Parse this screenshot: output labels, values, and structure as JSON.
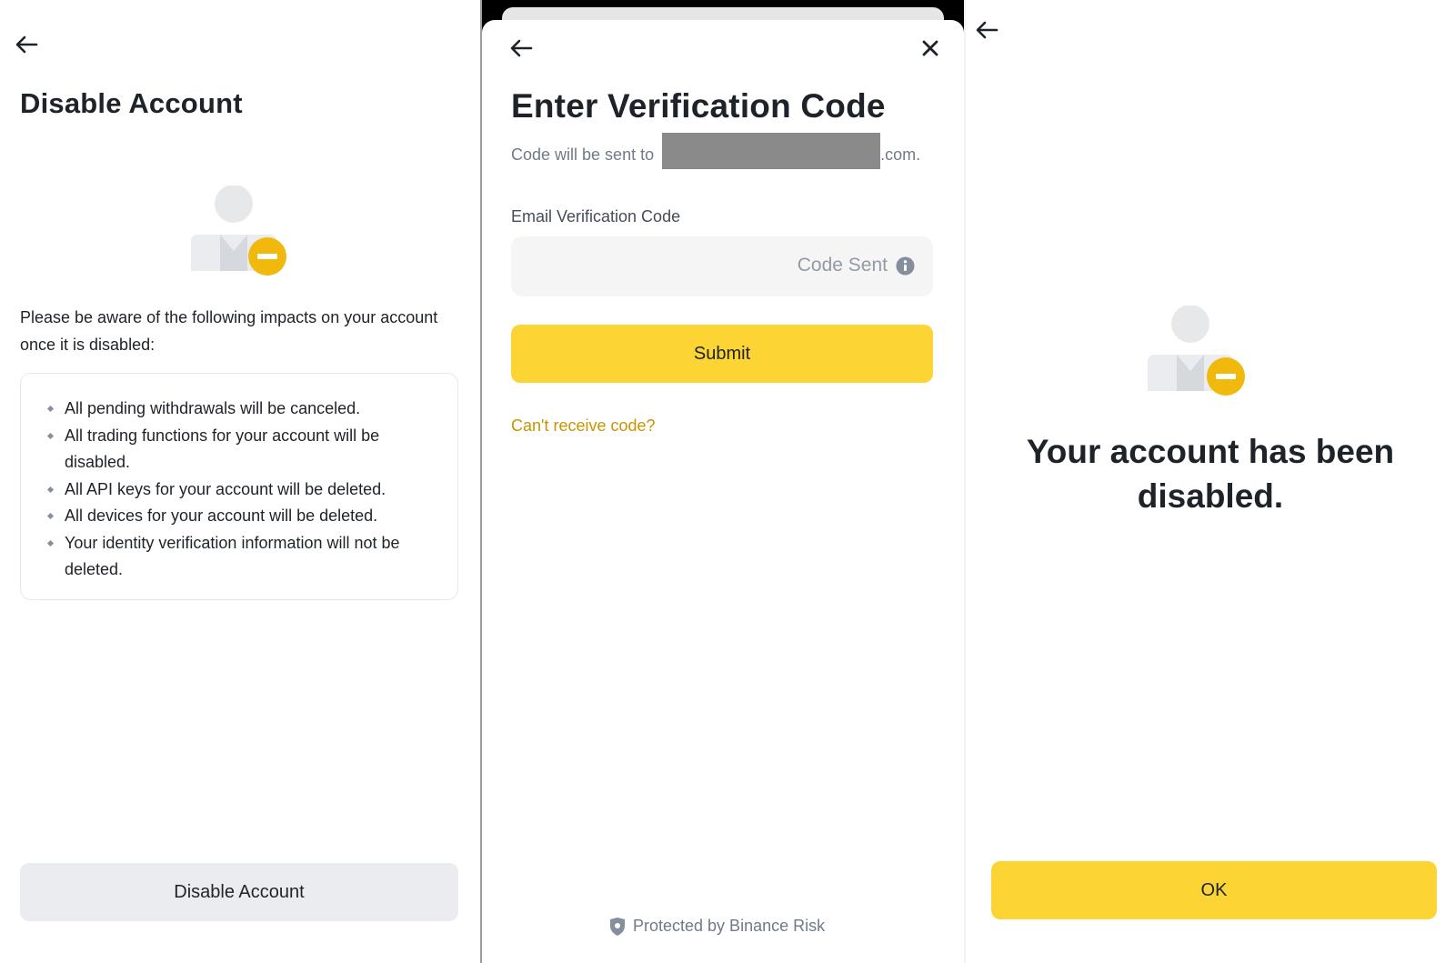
{
  "screen1": {
    "back_icon": "arrow-left-icon",
    "title": "Disable Account",
    "avatar_icon": "user-disabled-icon",
    "intro": "Please be aware of the following impacts on your account once it is disabled:",
    "impacts": [
      "All pending withdrawals will be canceled.",
      "All trading functions for your account will be disabled.",
      "All API keys for your account will be deleted.",
      "All devices for your account will be deleted.",
      "Your identity verification information will not be deleted."
    ],
    "button_label": "Disable Account"
  },
  "screen2": {
    "back_icon": "arrow-left-icon",
    "close_icon": "close-icon",
    "title": "Enter Verification Code",
    "subtitle_prefix": "Code will be sent to",
    "subtitle_suffix": ".com.",
    "field_label": "Email Verification Code",
    "code_value": "",
    "code_status": "Code Sent",
    "info_icon": "info-icon",
    "submit_label": "Submit",
    "cant_receive_label": "Can't receive code?",
    "protected_label": "Protected by Binance Risk",
    "shield_icon": "shield-icon"
  },
  "screen3": {
    "back_icon": "arrow-left-icon",
    "avatar_icon": "user-disabled-icon",
    "status_text": "Your account has been disabled.",
    "ok_label": "OK"
  },
  "colors": {
    "accent_yellow": "#fcd535",
    "badge_yellow": "#f0b90b",
    "link_gold": "#c99400",
    "disabled_button_bg": "#eaecef",
    "text_primary": "#1e2329",
    "text_secondary": "#707a8a"
  }
}
